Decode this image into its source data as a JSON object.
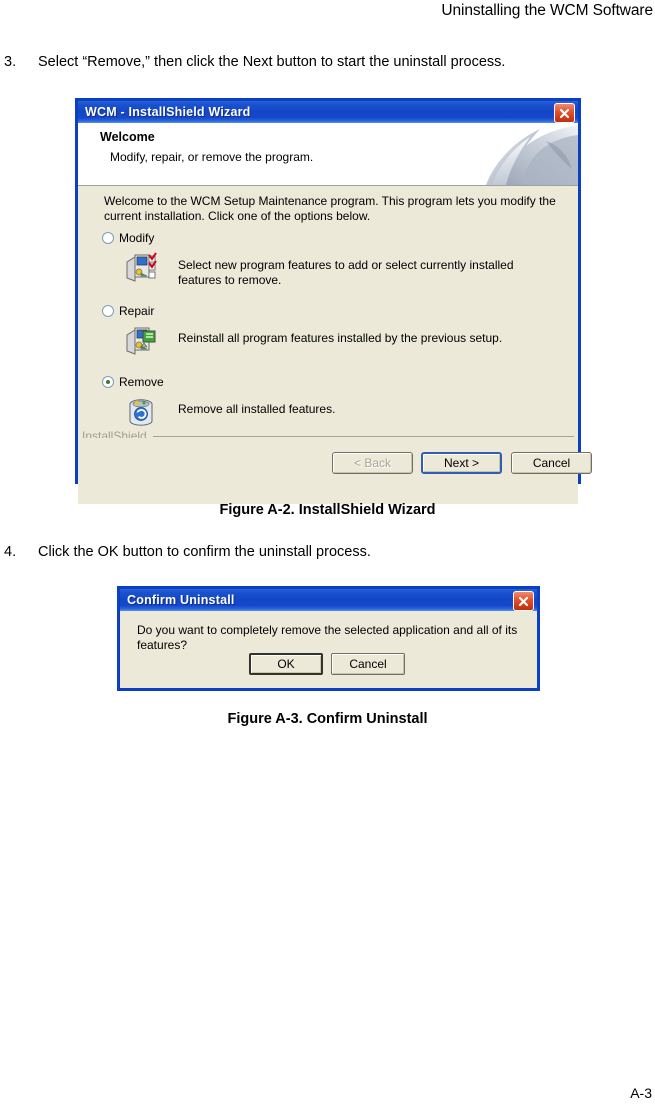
{
  "page": {
    "header_title": "Uninstalling the WCM Software",
    "footer_page_number": "A-3"
  },
  "steps": [
    {
      "number": "3.",
      "text": "Select “Remove,” then click the Next button to start the uninstall process."
    },
    {
      "number": "4.",
      "text": "Click the OK button to confirm the uninstall process."
    }
  ],
  "figures": [
    {
      "caption": "Figure A-2.  InstallShield Wizard"
    },
    {
      "caption": "Figure A-3.  Confirm Uninstall"
    }
  ],
  "installshield_wizard": {
    "titlebar": {
      "title": "WCM - InstallShield Wizard",
      "close_label": "Close"
    },
    "header": {
      "title": "Welcome",
      "subtitle": "Modify, repair, or remove the program."
    },
    "intro": "Welcome to the WCM Setup Maintenance program. This program lets you modify the current installation. Click one of the options below.",
    "options": [
      {
        "id": "modify",
        "label": "Modify",
        "selected": false,
        "description": "Select new program features to add or select currently installed features to remove.",
        "icon": "modify-features-icon"
      },
      {
        "id": "repair",
        "label": "Repair",
        "selected": false,
        "description": "Reinstall all program features installed by the previous setup.",
        "icon": "repair-features-icon"
      },
      {
        "id": "remove",
        "label": "Remove",
        "selected": true,
        "description": "Remove all installed features.",
        "icon": "recycle-bin-icon"
      }
    ],
    "brand": "InstallShield",
    "buttons": [
      {
        "id": "back",
        "label": "< Back",
        "state": "disabled"
      },
      {
        "id": "next",
        "label": "Next >",
        "state": "default"
      },
      {
        "id": "cancel",
        "label": "Cancel",
        "state": "normal"
      }
    ]
  },
  "confirm_uninstall": {
    "titlebar": {
      "title": "Confirm Uninstall",
      "close_label": "Close"
    },
    "message": "Do you want to completely remove the selected application and all of its features?",
    "buttons": [
      {
        "id": "ok",
        "label": "OK",
        "state": "default"
      },
      {
        "id": "cancel",
        "label": "Cancel",
        "state": "normal"
      }
    ]
  },
  "colors": {
    "titlebar_blue": "#1346c6",
    "window_border_blue": "#0b3fc4",
    "dialog_face": "#ece9d8",
    "close_button_red": "#c22d0e",
    "radio_dot_green": "#3a7d2c",
    "brand_gray": "#a09e90"
  }
}
